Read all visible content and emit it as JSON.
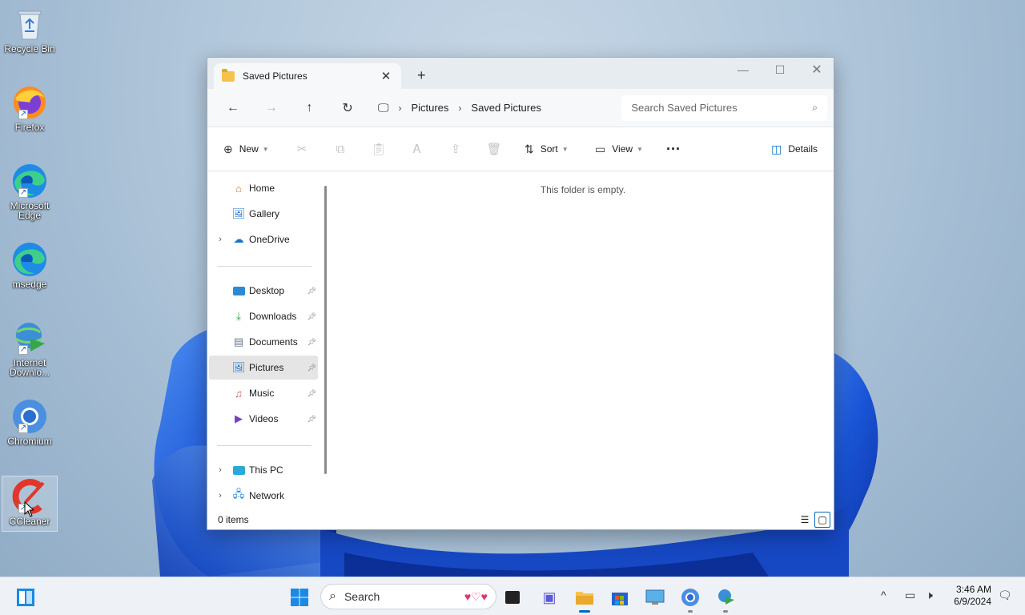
{
  "desktop": {
    "icons": [
      {
        "label": "Recycle Bin",
        "icon": "recycle-bin-icon"
      },
      {
        "label": "Firefox",
        "icon": "firefox-icon"
      },
      {
        "label": "Microsoft Edge",
        "icon": "edge-icon"
      },
      {
        "label": "msedge",
        "icon": "edge-icon"
      },
      {
        "label": "Internet Downlo...",
        "icon": "internet-download-manager-icon"
      },
      {
        "label": "Chromium",
        "icon": "chromium-icon"
      },
      {
        "label": "CCleaner",
        "icon": "ccleaner-icon"
      }
    ]
  },
  "explorer": {
    "tab_title": "Saved Pictures",
    "breadcrumb": [
      "Pictures",
      "Saved Pictures"
    ],
    "search_placeholder": "Search Saved Pictures",
    "toolbar": {
      "new": "New",
      "sort": "Sort",
      "view": "View",
      "details": "Details"
    },
    "nav": {
      "home": "Home",
      "gallery": "Gallery",
      "onedrive": "OneDrive",
      "desktop": "Desktop",
      "downloads": "Downloads",
      "documents": "Documents",
      "pictures": "Pictures",
      "music": "Music",
      "videos": "Videos",
      "thispc": "This PC",
      "network": "Network"
    },
    "empty_message": "This folder is empty.",
    "status": "0 items"
  },
  "taskbar": {
    "search_placeholder": "Search",
    "time": "3:46 AM",
    "date": "6/9/2024"
  },
  "colors": {
    "accent": "#0067c0",
    "wallpaper_bloom": "#1a5fd6"
  }
}
